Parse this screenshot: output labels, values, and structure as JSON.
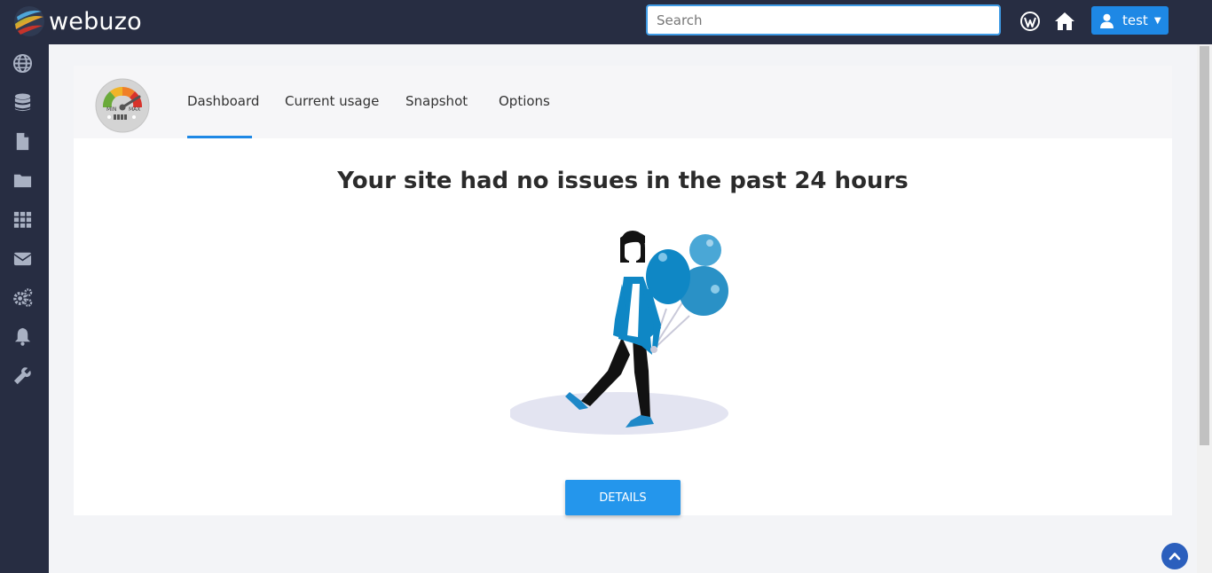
{
  "app": {
    "logo_text": "webuzo"
  },
  "search": {
    "placeholder": "Search",
    "value": ""
  },
  "header": {
    "icons": [
      "wordpress-icon",
      "home-icon"
    ],
    "user": {
      "label": "test",
      "icon": "user-icon"
    }
  },
  "sidebar": {
    "items": [
      {
        "icon": "globe-icon"
      },
      {
        "icon": "database-icon"
      },
      {
        "icon": "file-icon"
      },
      {
        "icon": "folder-icon"
      },
      {
        "icon": "grid-icon"
      },
      {
        "icon": "envelope-icon"
      },
      {
        "icon": "gears-icon"
      },
      {
        "icon": "bell-icon"
      },
      {
        "icon": "wrench-icon"
      }
    ]
  },
  "card": {
    "gauge": {
      "min_label": "MIN",
      "max_label": "MAX"
    },
    "tabs": [
      {
        "label": "Dashboard",
        "active": true
      },
      {
        "label": "Current usage",
        "active": false
      },
      {
        "label": "Snapshot",
        "active": false
      },
      {
        "label": "Options",
        "active": false
      }
    ],
    "headline": "Your site had no issues in the past 24 hours",
    "details_label": "DETAILS"
  },
  "colors": {
    "topbar": "#272d42",
    "accent": "#1e88e5",
    "balloon": "#0f87c5",
    "background": "#f3f4f7"
  }
}
